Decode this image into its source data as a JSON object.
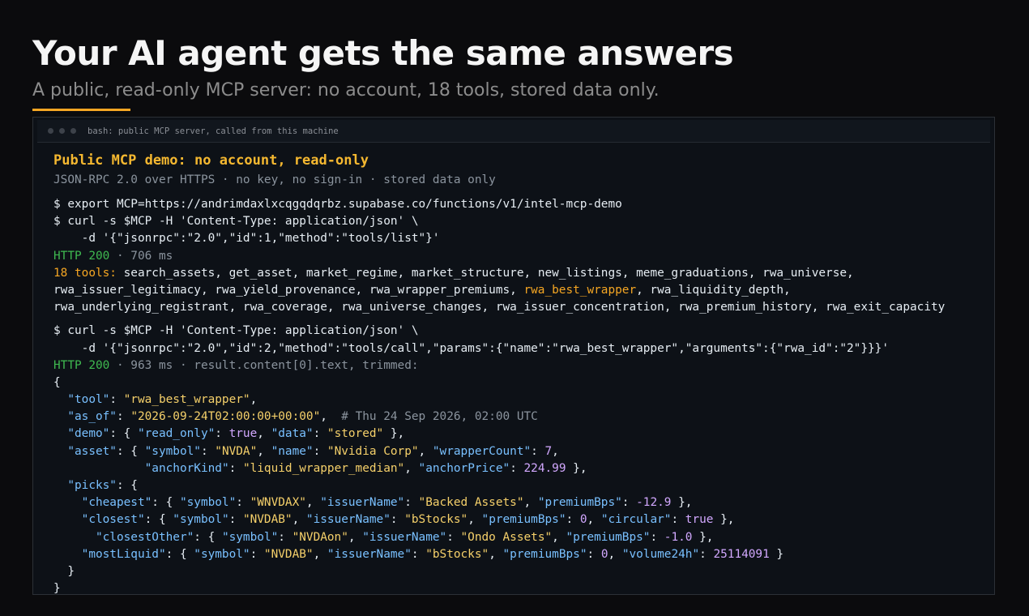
{
  "header": {
    "title": "Your AI agent gets the same answers",
    "subtitle": "A public, read-only MCP server: no account, 18 tools, stored data only.",
    "accent_color": "#f5a623"
  },
  "terminal": {
    "window_title": "bash: public MCP server, called from this machine",
    "demo_title": "Public MCP demo: no account, read-only",
    "demo_meta": "JSON-RPC 2.0 over HTTPS · no key, no sign-in · stored data only",
    "lines": [
      {
        "kind": "gap-s"
      },
      {
        "kind": "plain",
        "segments": [
          {
            "t": "$ ",
            "c": "prompt"
          },
          {
            "t": "export MCP=https://andrimdaxlxcqgqdqrbz.supabase.co/functions/v1/intel-mcp-demo",
            "c": "text"
          }
        ]
      },
      {
        "kind": "plain",
        "segments": [
          {
            "t": "$ ",
            "c": "prompt"
          },
          {
            "t": "curl -s $MCP -H 'Content-Type: application/json' \\",
            "c": "text"
          }
        ]
      },
      {
        "kind": "plain",
        "segments": [
          {
            "t": "    -d '{\"jsonrpc\":\"2.0\",\"id\":1,\"method\":\"tools/list\"}'",
            "c": "text"
          }
        ]
      },
      {
        "kind": "plain",
        "segments": [
          {
            "t": "HTTP 200",
            "c": "http"
          },
          {
            "t": " · 706 ms",
            "c": "dim"
          }
        ]
      },
      {
        "kind": "plain",
        "segments": [
          {
            "t": "18 tools:",
            "c": "orange"
          },
          {
            "t": " search_assets, get_asset, market_regime, market_structure, new_listings, meme_graduations, rwa_universe,",
            "c": "text"
          }
        ]
      },
      {
        "kind": "plain",
        "segments": [
          {
            "t": "rwa_issuer_legitimacy, rwa_yield_provenance, rwa_wrapper_premiums, ",
            "c": "text"
          },
          {
            "t": "rwa_best_wrapper",
            "c": "orange"
          },
          {
            "t": ", rwa_liquidity_depth,",
            "c": "text"
          }
        ]
      },
      {
        "kind": "plain",
        "segments": [
          {
            "t": "rwa_underlying_registrant, rwa_coverage, rwa_universe_changes, rwa_issuer_concentration, rwa_premium_history, rwa_exit_capacity",
            "c": "text"
          }
        ]
      },
      {
        "kind": "gap-m"
      },
      {
        "kind": "plain",
        "segments": [
          {
            "t": "$ ",
            "c": "prompt"
          },
          {
            "t": "curl -s $MCP -H 'Content-Type: application/json' \\",
            "c": "text"
          }
        ]
      },
      {
        "kind": "plain",
        "segments": [
          {
            "t": "    -d '{\"jsonrpc\":\"2.0\",\"id\":2,\"method\":\"tools/call\",\"params\":{\"name\":\"rwa_best_wrapper\",\"arguments\":{\"rwa_id\":\"2\"}}}'",
            "c": "text"
          }
        ]
      },
      {
        "kind": "plain",
        "segments": [
          {
            "t": "HTTP 200",
            "c": "http"
          },
          {
            "t": " · 963 ms · result.content[0].text, trimmed:",
            "c": "dim"
          }
        ]
      },
      {
        "kind": "plain",
        "segments": [
          {
            "t": "{",
            "c": "punct"
          }
        ]
      },
      {
        "kind": "plain",
        "segments": [
          {
            "t": "  ",
            "c": "punct"
          },
          {
            "t": "\"tool\"",
            "c": "key"
          },
          {
            "t": ": ",
            "c": "punct"
          },
          {
            "t": "\"rwa_best_wrapper\"",
            "c": "str"
          },
          {
            "t": ",",
            "c": "punct"
          }
        ]
      },
      {
        "kind": "plain",
        "segments": [
          {
            "t": "  ",
            "c": "punct"
          },
          {
            "t": "\"as_of\"",
            "c": "key"
          },
          {
            "t": ": ",
            "c": "punct"
          },
          {
            "t": "\"2026-09-24T02:00:00+00:00\"",
            "c": "str"
          },
          {
            "t": ",  ",
            "c": "punct"
          },
          {
            "t": "# Thu 24 Sep 2026, 02:00 UTC",
            "c": "dim"
          }
        ]
      },
      {
        "kind": "plain",
        "segments": [
          {
            "t": "  ",
            "c": "punct"
          },
          {
            "t": "\"demo\"",
            "c": "key"
          },
          {
            "t": ": { ",
            "c": "punct"
          },
          {
            "t": "\"read_only\"",
            "c": "key"
          },
          {
            "t": ": ",
            "c": "punct"
          },
          {
            "t": "true",
            "c": "bool"
          },
          {
            "t": ", ",
            "c": "punct"
          },
          {
            "t": "\"data\"",
            "c": "key"
          },
          {
            "t": ": ",
            "c": "punct"
          },
          {
            "t": "\"stored\"",
            "c": "str"
          },
          {
            "t": " },",
            "c": "punct"
          }
        ]
      },
      {
        "kind": "plain",
        "segments": [
          {
            "t": "  ",
            "c": "punct"
          },
          {
            "t": "\"asset\"",
            "c": "key"
          },
          {
            "t": ": { ",
            "c": "punct"
          },
          {
            "t": "\"symbol\"",
            "c": "key"
          },
          {
            "t": ": ",
            "c": "punct"
          },
          {
            "t": "\"NVDA\"",
            "c": "str"
          },
          {
            "t": ", ",
            "c": "punct"
          },
          {
            "t": "\"name\"",
            "c": "key"
          },
          {
            "t": ": ",
            "c": "punct"
          },
          {
            "t": "\"Nvidia Corp\"",
            "c": "str"
          },
          {
            "t": ", ",
            "c": "punct"
          },
          {
            "t": "\"wrapperCount\"",
            "c": "key"
          },
          {
            "t": ": ",
            "c": "punct"
          },
          {
            "t": "7",
            "c": "num"
          },
          {
            "t": ",",
            "c": "punct"
          }
        ]
      },
      {
        "kind": "plain",
        "segments": [
          {
            "t": "             ",
            "c": "punct"
          },
          {
            "t": "\"anchorKind\"",
            "c": "key"
          },
          {
            "t": ": ",
            "c": "punct"
          },
          {
            "t": "\"liquid_wrapper_median\"",
            "c": "str"
          },
          {
            "t": ", ",
            "c": "punct"
          },
          {
            "t": "\"anchorPrice\"",
            "c": "key"
          },
          {
            "t": ": ",
            "c": "punct"
          },
          {
            "t": "224.99",
            "c": "num"
          },
          {
            "t": " },",
            "c": "punct"
          }
        ]
      },
      {
        "kind": "plain",
        "segments": [
          {
            "t": "  ",
            "c": "punct"
          },
          {
            "t": "\"picks\"",
            "c": "key"
          },
          {
            "t": ": {",
            "c": "punct"
          }
        ]
      },
      {
        "kind": "plain",
        "segments": [
          {
            "t": "    ",
            "c": "punct"
          },
          {
            "t": "\"cheapest\"",
            "c": "key"
          },
          {
            "t": ": { ",
            "c": "punct"
          },
          {
            "t": "\"symbol\"",
            "c": "key"
          },
          {
            "t": ": ",
            "c": "punct"
          },
          {
            "t": "\"WNVDAX\"",
            "c": "str"
          },
          {
            "t": ", ",
            "c": "punct"
          },
          {
            "t": "\"issuerName\"",
            "c": "key"
          },
          {
            "t": ": ",
            "c": "punct"
          },
          {
            "t": "\"Backed Assets\"",
            "c": "str"
          },
          {
            "t": ", ",
            "c": "punct"
          },
          {
            "t": "\"premiumBps\"",
            "c": "key"
          },
          {
            "t": ": ",
            "c": "punct"
          },
          {
            "t": "-12.9",
            "c": "num"
          },
          {
            "t": " },",
            "c": "punct"
          }
        ]
      },
      {
        "kind": "plain",
        "segments": [
          {
            "t": "    ",
            "c": "punct"
          },
          {
            "t": "\"closest\"",
            "c": "key"
          },
          {
            "t": ": { ",
            "c": "punct"
          },
          {
            "t": "\"symbol\"",
            "c": "key"
          },
          {
            "t": ": ",
            "c": "punct"
          },
          {
            "t": "\"NVDAB\"",
            "c": "str"
          },
          {
            "t": ", ",
            "c": "punct"
          },
          {
            "t": "\"issuerName\"",
            "c": "key"
          },
          {
            "t": ": ",
            "c": "punct"
          },
          {
            "t": "\"bStocks\"",
            "c": "str"
          },
          {
            "t": ", ",
            "c": "punct"
          },
          {
            "t": "\"premiumBps\"",
            "c": "key"
          },
          {
            "t": ": ",
            "c": "punct"
          },
          {
            "t": "0",
            "c": "num"
          },
          {
            "t": ", ",
            "c": "punct"
          },
          {
            "t": "\"circular\"",
            "c": "key"
          },
          {
            "t": ": ",
            "c": "punct"
          },
          {
            "t": "true",
            "c": "bool"
          },
          {
            "t": " },",
            "c": "punct"
          }
        ]
      },
      {
        "kind": "plain",
        "segments": [
          {
            "t": "      ",
            "c": "punct"
          },
          {
            "t": "\"closestOther\"",
            "c": "key"
          },
          {
            "t": ": { ",
            "c": "punct"
          },
          {
            "t": "\"symbol\"",
            "c": "key"
          },
          {
            "t": ": ",
            "c": "punct"
          },
          {
            "t": "\"NVDAon\"",
            "c": "str"
          },
          {
            "t": ", ",
            "c": "punct"
          },
          {
            "t": "\"issuerName\"",
            "c": "key"
          },
          {
            "t": ": ",
            "c": "punct"
          },
          {
            "t": "\"Ondo Assets\"",
            "c": "str"
          },
          {
            "t": ", ",
            "c": "punct"
          },
          {
            "t": "\"premiumBps\"",
            "c": "key"
          },
          {
            "t": ": ",
            "c": "punct"
          },
          {
            "t": "-1.0",
            "c": "num"
          },
          {
            "t": " },",
            "c": "punct"
          }
        ]
      },
      {
        "kind": "plain",
        "segments": [
          {
            "t": "    ",
            "c": "punct"
          },
          {
            "t": "\"mostLiquid\"",
            "c": "key"
          },
          {
            "t": ": { ",
            "c": "punct"
          },
          {
            "t": "\"symbol\"",
            "c": "key"
          },
          {
            "t": ": ",
            "c": "punct"
          },
          {
            "t": "\"NVDAB\"",
            "c": "str"
          },
          {
            "t": ", ",
            "c": "punct"
          },
          {
            "t": "\"issuerName\"",
            "c": "key"
          },
          {
            "t": ": ",
            "c": "punct"
          },
          {
            "t": "\"bStocks\"",
            "c": "str"
          },
          {
            "t": ", ",
            "c": "punct"
          },
          {
            "t": "\"premiumBps\"",
            "c": "key"
          },
          {
            "t": ": ",
            "c": "punct"
          },
          {
            "t": "0",
            "c": "num"
          },
          {
            "t": ", ",
            "c": "punct"
          },
          {
            "t": "\"volume24h\"",
            "c": "key"
          },
          {
            "t": ": ",
            "c": "punct"
          },
          {
            "t": "25114091",
            "c": "num"
          },
          {
            "t": " }",
            "c": "punct"
          }
        ]
      },
      {
        "kind": "plain",
        "segments": [
          {
            "t": "  }",
            "c": "punct"
          }
        ]
      },
      {
        "kind": "plain",
        "segments": [
          {
            "t": "}",
            "c": "punct"
          }
        ]
      }
    ]
  }
}
